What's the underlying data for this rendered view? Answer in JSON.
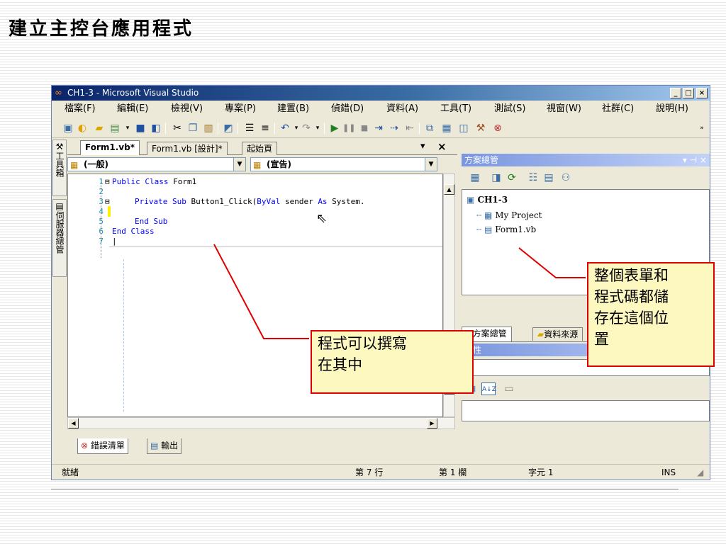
{
  "slide": {
    "title": "建立主控台應用程式"
  },
  "window": {
    "title": "CH1-3 - Microsoft Visual Studio",
    "minimize": "_",
    "maximize": "□",
    "close": "×"
  },
  "menu": [
    "檔案(F)",
    "編輯(E)",
    "檢視(V)",
    "專案(P)",
    "建置(B)",
    "偵錯(D)",
    "資料(A)",
    "工具(T)",
    "測試(S)",
    "視窗(W)",
    "社群(C)",
    "說明(H)"
  ],
  "sidebar": {
    "toolbox": "工具箱",
    "server_explorer": "伺服器總管"
  },
  "editor": {
    "tabs": [
      "Form1.vb*",
      "Form1.vb [設計]*",
      "起始頁"
    ],
    "tab_menu": "▾",
    "tab_close": "×",
    "combo_left": "(一般)",
    "combo_right": "(宣告)",
    "lines": [
      {
        "n": "1",
        "pre": "",
        "kw": "Public Class",
        "post": " Form1"
      },
      {
        "n": "2",
        "pre": "",
        "kw": "",
        "post": ""
      },
      {
        "n": "3",
        "pre": "    ",
        "kw": "Private Sub",
        "post": " Button1_Click(",
        "kw2": "ByVal",
        "post2": " sender ",
        "kw3": "As",
        "post3": " System."
      },
      {
        "n": "4",
        "pre": "",
        "kw": "",
        "post": ""
      },
      {
        "n": "5",
        "pre": "    ",
        "kw": "End Sub",
        "post": ""
      },
      {
        "n": "6",
        "pre": "",
        "kw": "End Class",
        "post": ""
      },
      {
        "n": "7",
        "pre": "",
        "kw": "",
        "post": "|"
      }
    ]
  },
  "solution": {
    "header": "方案總管",
    "root": "CH1-3",
    "items": [
      "My Project",
      "Form1.vb"
    ],
    "bottom_tabs": [
      "方案總管",
      "資料來源"
    ]
  },
  "properties": {
    "header": "屬性",
    "sort_alpha": "A↓Z"
  },
  "output_tabs": [
    "錯誤清單",
    "輸出"
  ],
  "status": {
    "ready": "就緒",
    "line": "第 7 行",
    "col": "第 1 欄",
    "char": "字元 1",
    "mode": "INS"
  },
  "callouts": {
    "code": [
      "程式可以撰寫",
      "在其中"
    ],
    "solution": [
      "整個表單和",
      "程式碼都儲",
      "存在這個位",
      "置"
    ]
  },
  "colors": {
    "callout_border": "#e00000",
    "callout_bg": "#fdf7c0",
    "keyword": "#0000ff",
    "line_number": "#2b91af"
  }
}
